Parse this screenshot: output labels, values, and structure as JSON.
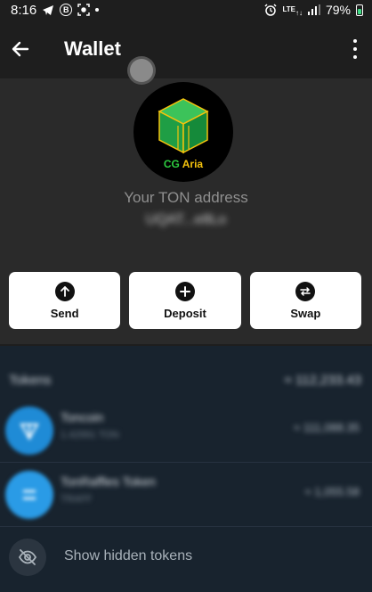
{
  "status_bar": {
    "time": "8:16",
    "b_badge": "B",
    "network": "LTE",
    "battery": "79%"
  },
  "header": {
    "title": "Wallet"
  },
  "logo": {
    "brand_cg": "CG",
    "brand_aria": "Aria",
    "colors": {
      "cube_top": "#3cc35a",
      "cube_left": "#1f9e45",
      "cube_right": "#158a3a",
      "edge": "#f4c20d"
    }
  },
  "address": {
    "label": "Your TON address",
    "value": "UQAT...e8Lo"
  },
  "actions": [
    {
      "label": "Send",
      "icon": "arrow-up-icon"
    },
    {
      "label": "Deposit",
      "icon": "plus-icon"
    },
    {
      "label": "Swap",
      "icon": "swap-icon"
    }
  ],
  "tokens": {
    "header_label": "Tokens",
    "header_total": "≈ 112,233.43",
    "items": [
      {
        "name": "Toncoin",
        "sub": "1.42991 TON",
        "amount": "≈ 111,088.35"
      },
      {
        "name": "TonRaffles Token",
        "sub": "TRAFF",
        "amount": "≈ 1,055.58"
      }
    ],
    "show_hidden_label": "Show hidden tokens"
  }
}
